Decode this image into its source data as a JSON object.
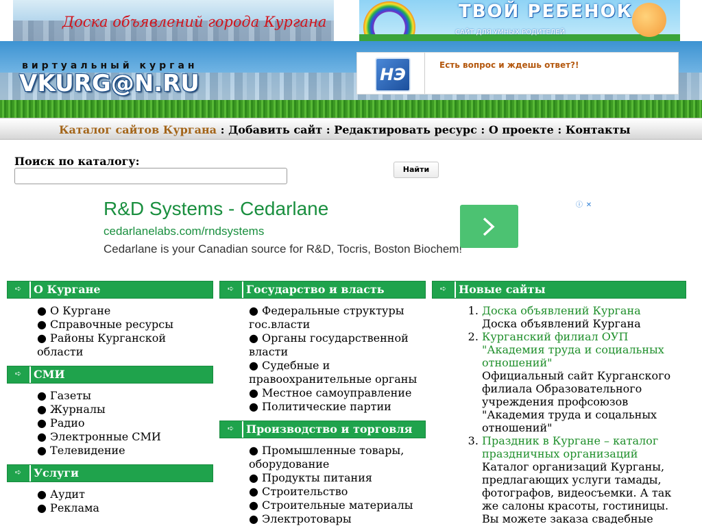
{
  "top_banners": {
    "left_text": "Доска объявлений города Кургана",
    "right_title": "ТВОЙ РЕБЕНОК",
    "right_subtitle": "САЙТ ДЛЯ УМНЫХ РОДИТЕЛЕЙ"
  },
  "header": {
    "logo_sub": "виртуальный курган",
    "logo_main": "VKURG@N.RU",
    "ad_icon_text": "НЭ",
    "ad_question": "Есть вопрос и ждешь ответ?!"
  },
  "nav": {
    "current": "Каталог сайтов Кургана",
    "separator": " : ",
    "links": [
      "Добавить сайт",
      "Редактировать ресурс",
      "О проекте",
      "Контакты"
    ]
  },
  "search": {
    "label": "Поиск по каталогу:",
    "value": "",
    "button": "Найти"
  },
  "google_ad": {
    "title": "R&D Systems - Cedarlane",
    "url": "cedarlanelabs.com/rndsystems",
    "description": "Cedarlane is your Canadian source for R&D, Tocris, Boston Biochem!"
  },
  "columns": {
    "col1": [
      {
        "title": "О Кургане",
        "items": [
          "О Кургане",
          "Справочные ресурсы",
          "Районы Курганской области"
        ]
      },
      {
        "title": "СМИ",
        "items": [
          "Газеты",
          "Журналы",
          "Радио",
          "Электронные СМИ",
          "Телевидение"
        ]
      },
      {
        "title": "Услуги",
        "items": [
          "Аудит",
          "Реклама"
        ]
      }
    ],
    "col2": [
      {
        "title": "Государство и власть",
        "items": [
          "Федеральные структуры гос.власти",
          "Органы государственной власти",
          "Судебные и правоохранительные органы",
          "Местное самоуправление",
          "Политические партии"
        ]
      },
      {
        "title": "Производство и торговля",
        "items": [
          "Промышленные товары, оборудование",
          "Продукты питания",
          "Строительство",
          "Строительные материалы",
          "Электротовары"
        ]
      }
    ],
    "col3": {
      "title": "Новые сайты",
      "items": [
        {
          "link": "Доска объявлений Кургана",
          "desc": "Доска объявлений Кургана"
        },
        {
          "link": "Курганский филиал ОУП \"Академия труда и социальных отношений\"",
          "desc": "Официальный сайт Курганского филиала Образовательного учреждения профсоюзов \"Академия труда и соцальных отношений\""
        },
        {
          "link": "Праздник в Кургане – каталог праздничных организаций",
          "desc": "Каталог организаций Курганы, предлагающих услуги тамады, фотографов, видеосъемки. А так же салоны красоты, гостиницы. Вы можете заказа свадебные"
        }
      ]
    }
  }
}
